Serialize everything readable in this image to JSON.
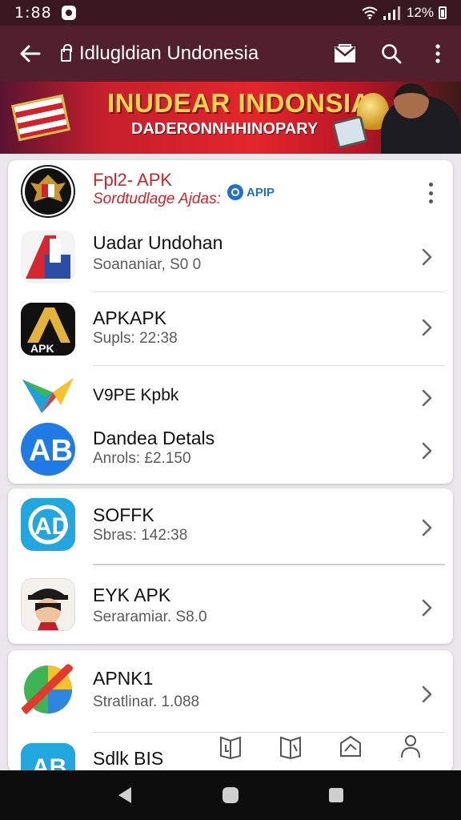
{
  "status": {
    "time": "1:88",
    "battery": "12%"
  },
  "app_bar": {
    "title": "Idlugldian Undonesia"
  },
  "banner": {
    "title": "INUDEAR INDONSIA",
    "subtitle": "DADERONNHHINOPARY"
  },
  "featured": {
    "title": "Fpl2- APK",
    "subtitle": "Sordtudlage Ajdas:",
    "badge": "APIP"
  },
  "apps": [
    {
      "title": "Uadar Undohan",
      "subtitle": "Soananiar, S0 0"
    },
    {
      "title": "APKAPK",
      "subtitle": "Supls: 22:38"
    },
    {
      "title": "V9PE Kpbk",
      "subtitle": ""
    },
    {
      "title": "Dandea Detals",
      "subtitle": "Anrols: £2.150"
    },
    {
      "title": "SOFFK",
      "subtitle": "Sbras: 142:38"
    },
    {
      "title": "EYK APK",
      "subtitle": "Seraramiar. S8.0"
    },
    {
      "title": "APNK1",
      "subtitle": "Stratlinar. 1.088"
    },
    {
      "title": "Sdlk BIS",
      "subtitle": ""
    }
  ],
  "colors": {
    "app_bar": "#521f2e",
    "status_bar": "#3a1822",
    "accent_red": "#d2232a",
    "badge_blue": "#1f6fd1"
  }
}
